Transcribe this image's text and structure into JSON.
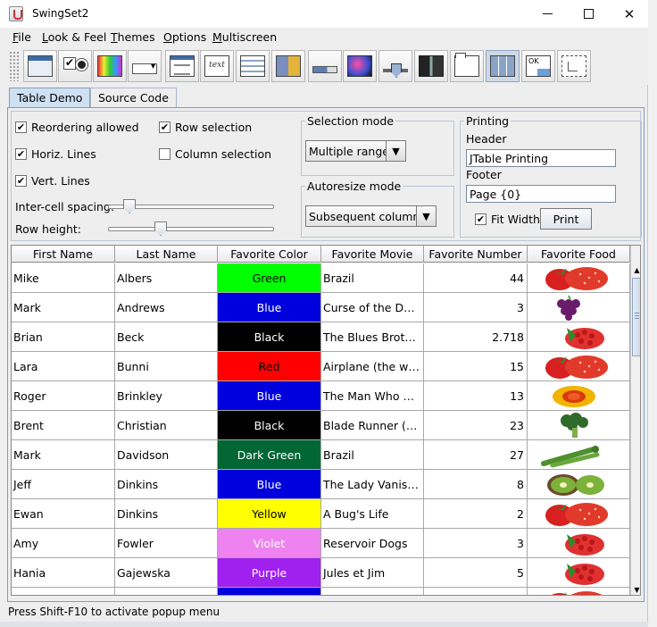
{
  "window": {
    "title": "SwingSet2"
  },
  "menu": [
    {
      "mnemonic": "F",
      "rest": "ile"
    },
    {
      "mnemonic": "L",
      "rest": "ook & Feel"
    },
    {
      "mnemonic": "T",
      "rest": "hemes"
    },
    {
      "mnemonic": "O",
      "rest": "ptions"
    },
    {
      "mnemonic": "M",
      "rest": "ultiscreen"
    }
  ],
  "toolbar": {
    "icons": [
      "internal-frame-icon",
      "checkbox-radio-icon",
      "color-chooser-icon",
      "combobox-icon",
      "dialog-icon",
      "text-editor-icon",
      "list-icon",
      "option-pane-icon",
      "progress-bar-icon",
      "scroll-pane-icon",
      "slider-icon",
      "split-pane-icon",
      "tabbed-pane-icon",
      "table-icon",
      "tooltip-icon",
      "tree-icon"
    ],
    "selected": "table-icon",
    "tooltip_icon_text": "OK"
  },
  "tabs": [
    {
      "label": "Table Demo",
      "active": true
    },
    {
      "label": "Source Code",
      "active": false
    }
  ],
  "controls": {
    "reordering": {
      "label": "Reordering allowed",
      "checked": true
    },
    "horiz_lines": {
      "label": "Horiz. Lines",
      "checked": true
    },
    "vert_lines": {
      "label": "Vert. Lines",
      "checked": true
    },
    "row_selection": {
      "label": "Row selection",
      "checked": true
    },
    "column_selection": {
      "label": "Column selection",
      "checked": false
    },
    "inter_cell_spacing": {
      "label": "Inter-cell spacing:",
      "value_fraction": 0.1
    },
    "row_height": {
      "label": "Row height:",
      "value_fraction": 0.3
    },
    "selection_mode": {
      "title": "Selection mode",
      "value": "Multiple ranges"
    },
    "autoresize_mode": {
      "title": "Autoresize mode",
      "value": "Subsequent columns"
    },
    "printing": {
      "title": "Printing",
      "header_label": "Header",
      "header_value": "JTable Printing",
      "footer_label": "Footer",
      "footer_value": "Page {0}",
      "fit_width": {
        "label": "Fit Width",
        "checked": true
      },
      "print_button": "Print"
    }
  },
  "table": {
    "columns": [
      "First Name",
      "Last Name",
      "Favorite Color",
      "Favorite Movie",
      "Favorite Number",
      "Favorite Food"
    ],
    "rows": [
      {
        "first": "Mike",
        "last": "Albers",
        "color": "Green",
        "color_bg": "#00ff00",
        "color_fg": "#000000",
        "movie": "Brazil",
        "number": "44",
        "food": "strawberry"
      },
      {
        "first": "Mark",
        "last": "Andrews",
        "color": "Blue",
        "color_bg": "#0000dd",
        "color_fg": "#ffffff",
        "movie": "Curse of the Demon",
        "number": "3",
        "food": "grapes"
      },
      {
        "first": "Brian",
        "last": "Beck",
        "color": "Black",
        "color_bg": "#000000",
        "color_fg": "#ffffff",
        "movie": "The Blues Brothers",
        "number": "2.718",
        "food": "raspberry"
      },
      {
        "first": "Lara",
        "last": "Bunni",
        "color": "Red",
        "color_bg": "#ff0000",
        "color_fg": "#000000",
        "movie": "Airplane (the whol...",
        "number": "15",
        "food": "strawberry"
      },
      {
        "first": "Roger",
        "last": "Brinkley",
        "color": "Blue",
        "color_bg": "#0000dd",
        "color_fg": "#ffffff",
        "movie": "The Man Who Kne...",
        "number": "13",
        "food": "peach"
      },
      {
        "first": "Brent",
        "last": "Christian",
        "color": "Black",
        "color_bg": "#000000",
        "color_fg": "#ffffff",
        "movie": "Blade Runner (Dir...",
        "number": "23",
        "food": "broccoli"
      },
      {
        "first": "Mark",
        "last": "Davidson",
        "color": "Dark Green",
        "color_bg": "#006633",
        "color_fg": "#ffffff",
        "movie": "Brazil",
        "number": "27",
        "food": "asparagus"
      },
      {
        "first": "Jeff",
        "last": "Dinkins",
        "color": "Blue",
        "color_bg": "#0000dd",
        "color_fg": "#ffffff",
        "movie": "The Lady Vanishes",
        "number": "8",
        "food": "kiwi"
      },
      {
        "first": "Ewan",
        "last": "Dinkins",
        "color": "Yellow",
        "color_bg": "#ffff00",
        "color_fg": "#000000",
        "movie": "A Bug's Life",
        "number": "2",
        "food": "strawberry"
      },
      {
        "first": "Amy",
        "last": "Fowler",
        "color": "Violet",
        "color_bg": "#ee82ee",
        "color_fg": "#ffffff",
        "movie": "Reservoir Dogs",
        "number": "3",
        "food": "raspberry"
      },
      {
        "first": "Hania",
        "last": "Gajewska",
        "color": "Purple",
        "color_bg": "#a020f0",
        "color_fg": "#ffffff",
        "movie": "Jules et Jim",
        "number": "5",
        "food": "raspberry"
      },
      {
        "first": "",
        "last": "",
        "color": "",
        "color_bg": "#0000dd",
        "color_fg": "#ffffff",
        "movie": "",
        "number": "",
        "food": "strawberry"
      }
    ]
  },
  "status": {
    "text": "Press Shift-F10 to activate popup menu"
  }
}
